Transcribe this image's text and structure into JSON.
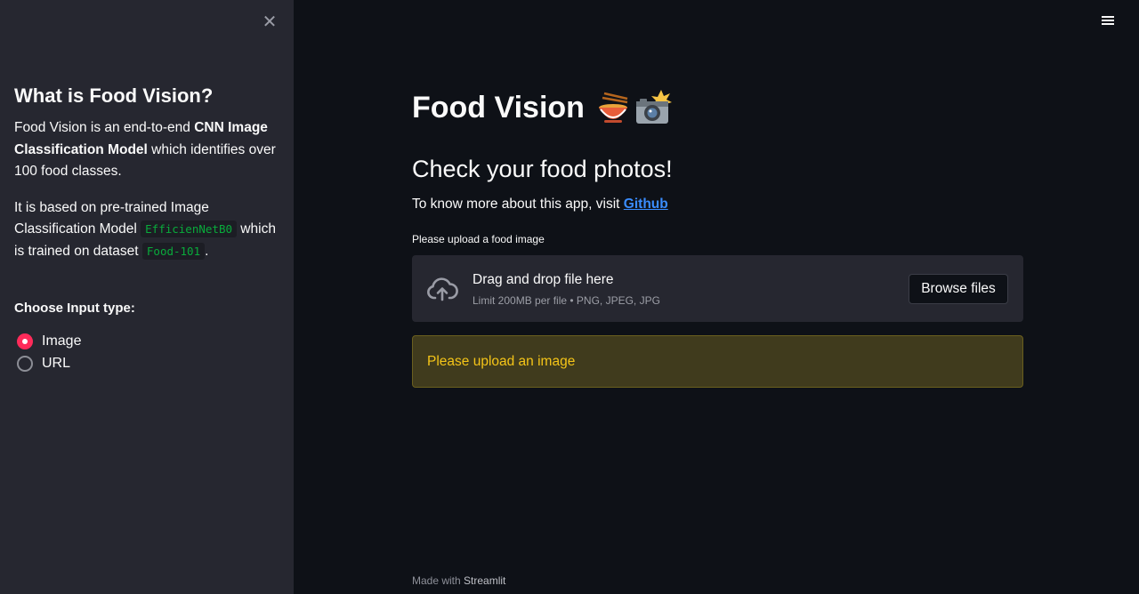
{
  "sidebar": {
    "close_glyph": "✕",
    "title": "What is Food Vision?",
    "p1_prefix": "Food Vision is an end-to-end ",
    "p1_bold": "CNN Image Classification Model",
    "p1_suffix": " which identifies over 100 food classes.",
    "p2_prefix": "It is based on pre-trained Image Classification Model ",
    "p2_code1": "EfficienNetB0",
    "p2_middle": " which is trained on dataset ",
    "p2_code2": "Food-101",
    "p2_suffix": ".",
    "choose_label": "Choose Input type:",
    "options": [
      {
        "label": "Image",
        "selected": true
      },
      {
        "label": "URL",
        "selected": false
      }
    ]
  },
  "header": {
    "menu_icon": "hamburger-icon"
  },
  "main": {
    "title": "Food Vision",
    "title_emojis": "🍜📸",
    "subtitle": "Check your food photos!",
    "info_prefix": "To know more about this app, visit ",
    "info_link": "Github",
    "upload_label": "Please upload a food image",
    "dropzone": {
      "title": "Drag and drop file here",
      "limit": "Limit 200MB per file • PNG, JPEG, JPG",
      "button": "Browse files",
      "icon": "cloud-upload-icon"
    },
    "warning": "Please upload an image"
  },
  "footer": {
    "prefix": "Made with ",
    "brand": "Streamlit"
  },
  "colors": {
    "background": "#0e1117",
    "sidebar": "#262730",
    "accent": "#ff2b5a",
    "link": "#3a8dff",
    "warning_text": "#f5c518",
    "warning_bg": "#403b1d"
  }
}
